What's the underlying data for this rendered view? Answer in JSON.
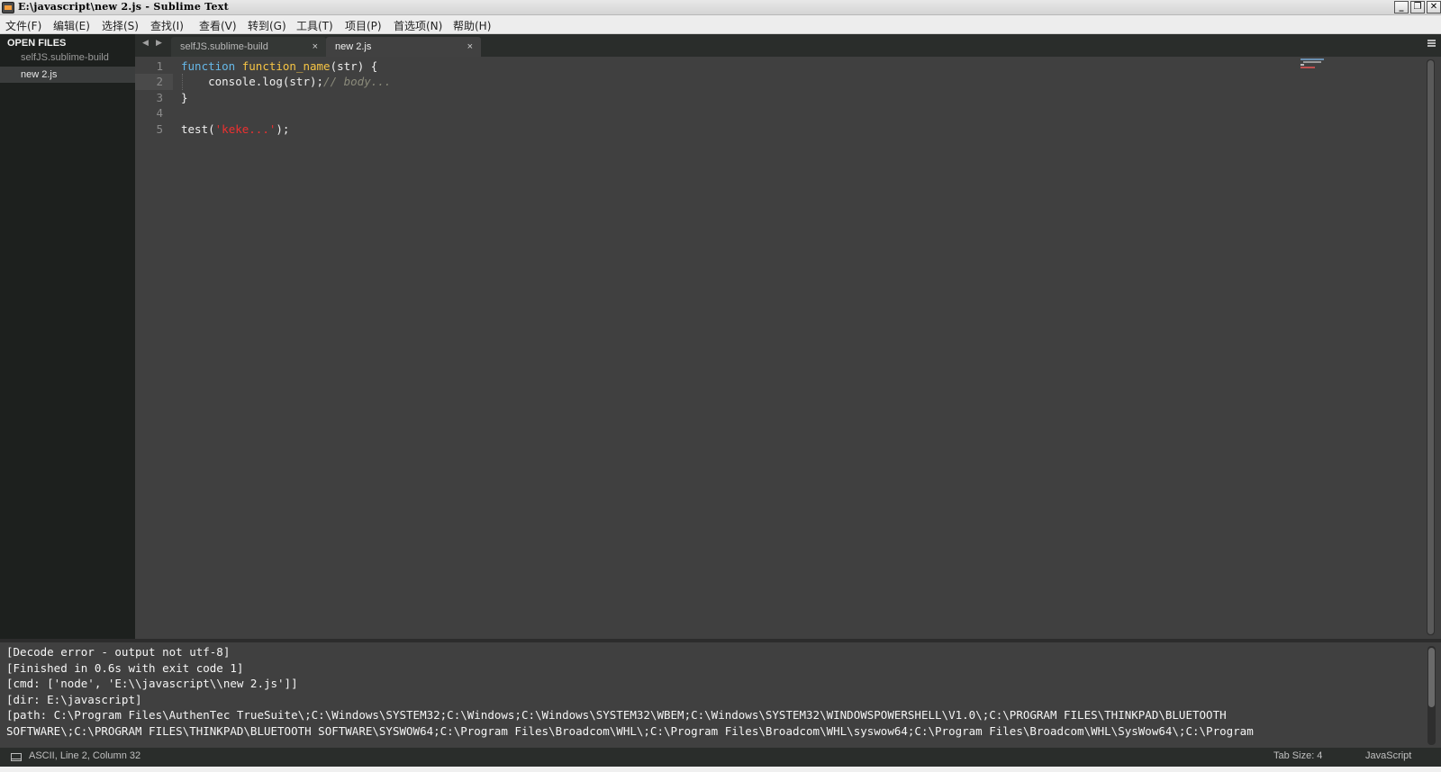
{
  "window": {
    "title": "E:\\javascript\\new 2.js - Sublime Text",
    "buttons": {
      "minimize": "_",
      "maximize": "❐",
      "close": "✕"
    }
  },
  "menu": [
    "文件(F)",
    "编辑(E)",
    "选择(S)",
    "查找(I)",
    "查看(V)",
    "转到(G)",
    "工具(T)",
    "项目(P)",
    "首选项(N)",
    "帮助(H)"
  ],
  "sidebar": {
    "header": "OPEN FILES",
    "files": [
      "selfJS.sublime-build",
      "new 2.js"
    ],
    "active_index": 1
  },
  "tabs": [
    {
      "label": "selfJS.sublime-build",
      "close": "×",
      "active": false
    },
    {
      "label": "new 2.js",
      "close": "×",
      "active": true
    }
  ],
  "tab_arrows": {
    "left": "◀",
    "right": "▶"
  },
  "editor": {
    "line_numbers": [
      "1",
      "2",
      "3",
      "4",
      "5"
    ],
    "current_line": 2,
    "code": {
      "l1_kw": "function",
      "l1_fn": "function_name",
      "l1_rest": "(str) {",
      "l2_code": "    console.log(str);",
      "l2_comment": "// body...",
      "l3": "}",
      "l4": "",
      "l5_a": "test(",
      "l5_str": "'keke...'",
      "l5_b": ");"
    },
    "colors": {
      "background": "#404040",
      "keyword": "#66b8e8",
      "function": "#f6c444",
      "comment": "#8a8a7a",
      "string": "#ee3030"
    }
  },
  "output": {
    "lines": [
      "[Decode error - output not utf-8]",
      "[Finished in 0.6s with exit code 1]",
      "[cmd: ['node', 'E:\\\\javascript\\\\new 2.js']]",
      "[dir: E:\\javascript]",
      "[path: C:\\Program Files\\AuthenTec TrueSuite\\;C:\\Windows\\SYSTEM32;C:\\Windows;C:\\Windows\\SYSTEM32\\WBEM;C:\\Windows\\SYSTEM32\\WINDOWSPOWERSHELL\\V1.0\\;C:\\PROGRAM FILES\\THINKPAD\\BLUETOOTH",
      "SOFTWARE\\;C:\\PROGRAM FILES\\THINKPAD\\BLUETOOTH SOFTWARE\\SYSWOW64;C:\\Program Files\\Broadcom\\WHL\\;C:\\Program Files\\Broadcom\\WHL\\syswow64;C:\\Program Files\\Broadcom\\WHL\\SysWow64\\;C:\\Program"
    ]
  },
  "status": {
    "main": "ASCII, Line 2, Column 32",
    "tab_size": "Tab Size: 4",
    "syntax": "JavaScript"
  },
  "icons": {
    "app": "sublime-text-icon",
    "panel_toggle": "panel-toggle-icon",
    "tab_menu": "tab-menu-icon"
  }
}
